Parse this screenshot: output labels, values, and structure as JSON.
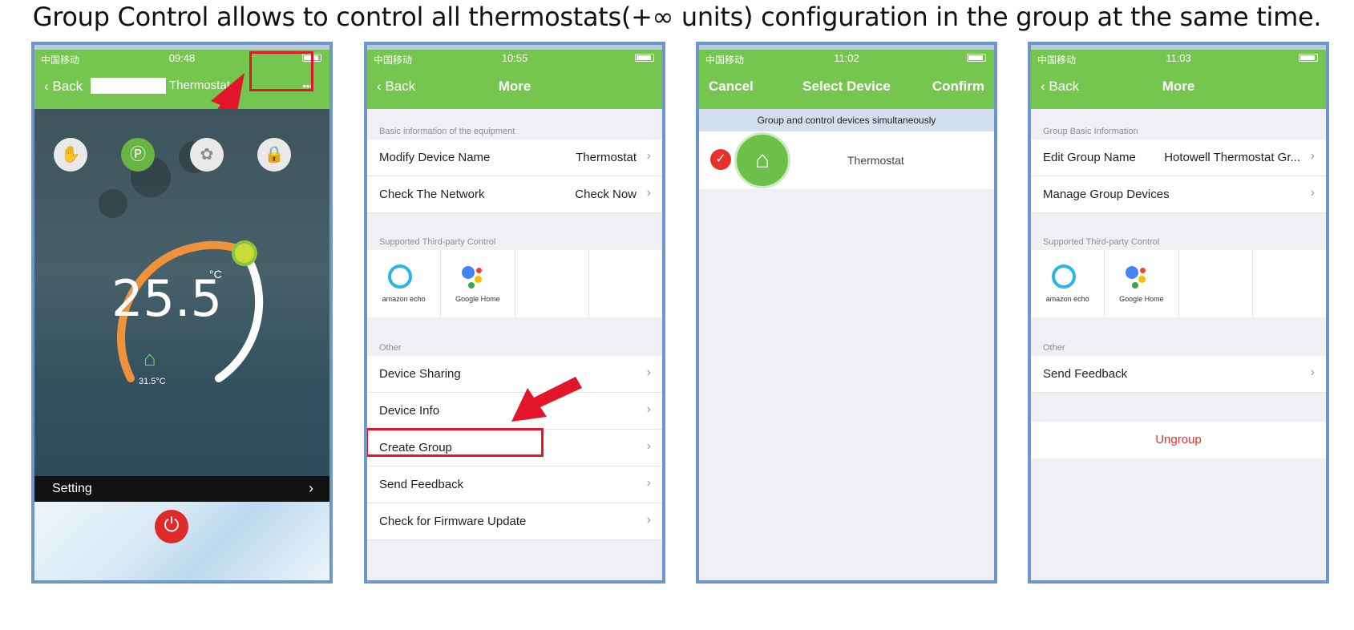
{
  "headline": "Group Control allows to control all thermostats(+∞  units) configuration in the group at the same time.",
  "colors": {
    "green": "#74c64f",
    "accent_red": "#e3152a",
    "frame": "#6f96c8"
  },
  "phone1": {
    "carrier": "中国移动",
    "time": "09:48",
    "back": "Back",
    "title": "Thermostat",
    "more": "•••",
    "setpoint": "25.5",
    "unit": "°C",
    "room_temp": "31.5°C",
    "setting": "Setting",
    "modes": [
      "hand-icon",
      "p-mode-icon",
      "leaf-icon",
      "lock-icon"
    ]
  },
  "phone2": {
    "carrier": "中国移动",
    "time": "10:55",
    "back": "Back",
    "title": "More",
    "section1": "Basic information of the equipment",
    "modify_name": {
      "label": "Modify Device Name",
      "value": "Thermostat"
    },
    "check_network": {
      "label": "Check The Network",
      "value": "Check Now"
    },
    "section2": "Supported Third-party Control",
    "amazon": "amazon echo",
    "google": "Google Home",
    "section3": "Other",
    "items": [
      "Device Sharing",
      "Device Info",
      "Create Group",
      "Send Feedback",
      "Check for Firmware Update"
    ]
  },
  "phone3": {
    "carrier": "中国移动",
    "time": "11:02",
    "cancel": "Cancel",
    "title": "Select Device",
    "confirm": "Confirm",
    "banner": "Group and control devices simultaneously",
    "device": "Thermostat"
  },
  "phone4": {
    "carrier": "中国移动",
    "time": "11:03",
    "back": "Back",
    "title": "More",
    "section1": "Group Basic Information",
    "edit_name": {
      "label": "Edit Group Name",
      "value": "Hotowell Thermostat Gr..."
    },
    "manage": "Manage Group Devices",
    "section2": "Supported Third-party Control",
    "amazon": "amazon echo",
    "google": "Google Home",
    "section3": "Other",
    "feedback": "Send Feedback",
    "ungroup": "Ungroup"
  }
}
